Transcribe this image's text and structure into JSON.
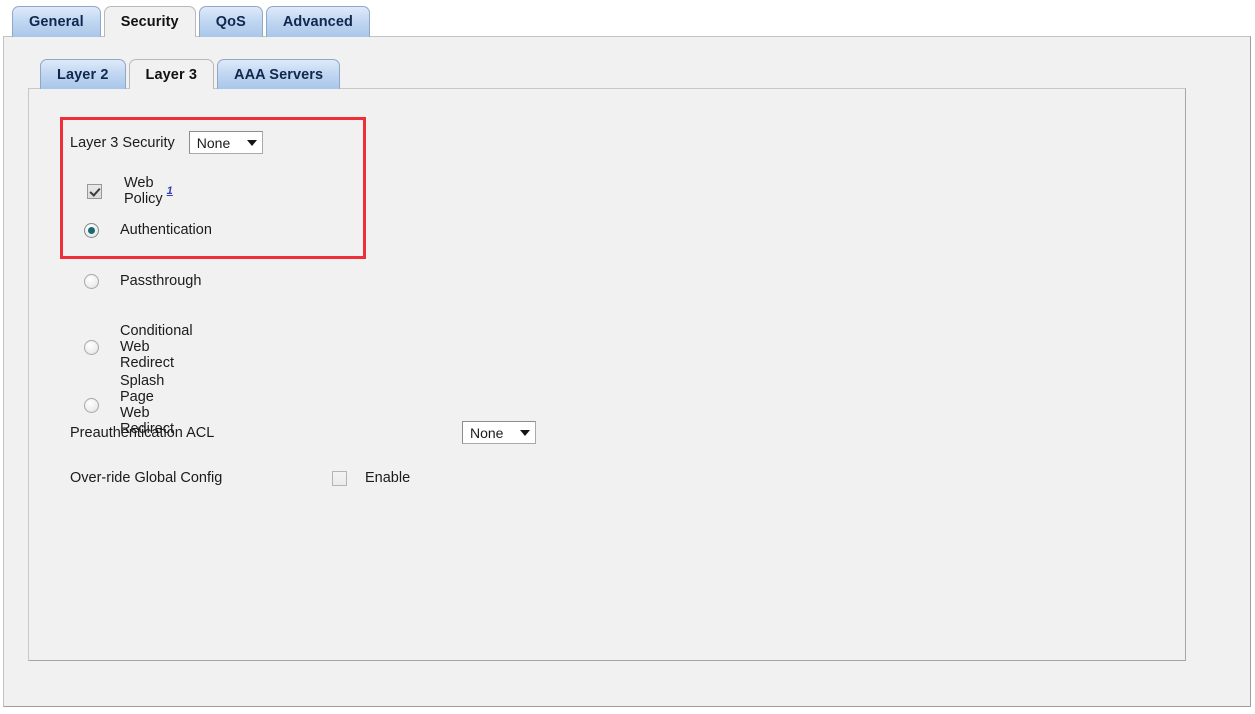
{
  "outer_tabs": [
    {
      "label": "General",
      "active": false
    },
    {
      "label": "Security",
      "active": true
    },
    {
      "label": "QoS",
      "active": false
    },
    {
      "label": "Advanced",
      "active": false
    }
  ],
  "inner_tabs": [
    {
      "label": "Layer 2",
      "active": false
    },
    {
      "label": "Layer 3",
      "active": true
    },
    {
      "label": "AAA Servers",
      "active": false
    }
  ],
  "form": {
    "layer3_security": {
      "label": "Layer 3 Security",
      "value": "None"
    },
    "web_policy": {
      "label": "Web Policy",
      "footnote": "1",
      "checked": true
    },
    "web_policy_options": [
      {
        "label": "Authentication",
        "selected": true
      },
      {
        "label": "Passthrough",
        "selected": false
      },
      {
        "label": "Conditional Web Redirect",
        "selected": false
      },
      {
        "label": "Splash Page Web Redirect",
        "selected": false
      }
    ],
    "preauthentication_acl": {
      "label": "Preauthentication ACL",
      "value": "None"
    },
    "override_global_config": {
      "label": "Over-ride Global Config",
      "enable_label": "Enable",
      "checked": false
    }
  },
  "annotation": {
    "highlight_color": "#ef2f38"
  }
}
